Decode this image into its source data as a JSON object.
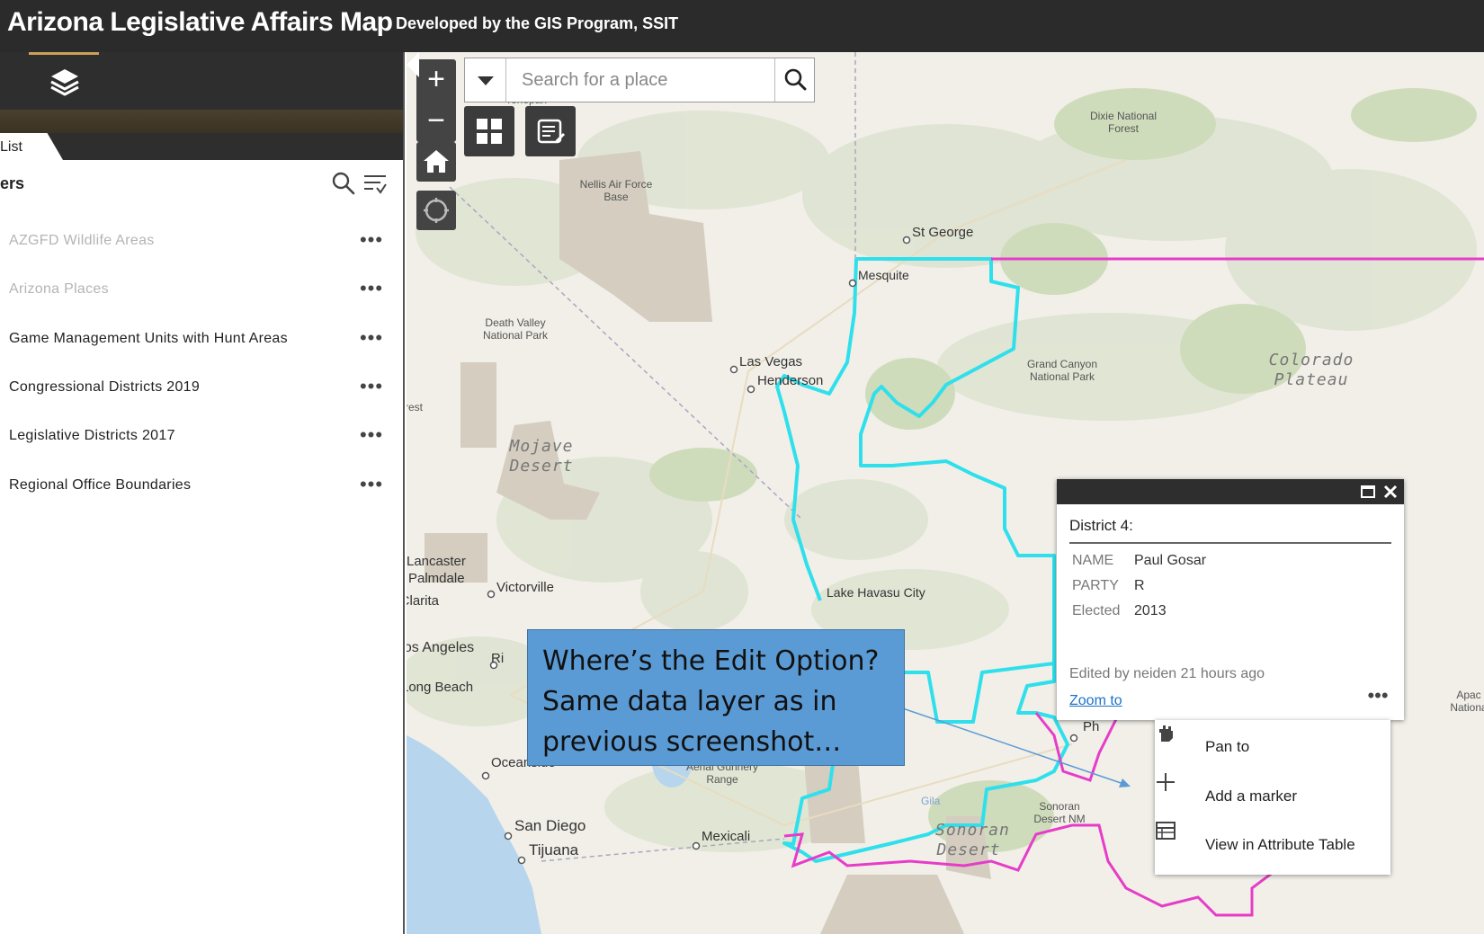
{
  "header": {
    "title": "Arizona Legislative Affairs Map",
    "subtitle": "Developed by the GIS Program, SSIT"
  },
  "panel": {
    "tab_label": "List",
    "section_title": "ers",
    "layers": [
      {
        "label": "AZGFD Wildlife Areas",
        "visible": false
      },
      {
        "label": "Arizona Places",
        "visible": false
      },
      {
        "label": "Game Management Units with Hunt Areas",
        "visible": true
      },
      {
        "label": "Congressional Districts 2019",
        "visible": true
      },
      {
        "label": "Legislative Districts 2017",
        "visible": true
      },
      {
        "label": "Regional Office Boundaries",
        "visible": true
      }
    ],
    "more_label": "•••"
  },
  "map": {
    "search": {
      "placeholder": "Search for a place"
    },
    "zoom_in_label": "+",
    "zoom_out_label": "−",
    "labels": {
      "tonopah": "Tonopah",
      "nellis": "Nellis Air Force Base",
      "dixie": "Dixie National Forest",
      "st_george": "St George",
      "mesquite": "Mesquite",
      "death_valley": "Death Valley National Park",
      "las_vegas": "Las Vegas",
      "henderson": "Henderson",
      "grand_canyon": "Grand Canyon National Park",
      "colorado_plateau": "Colorado Plateau",
      "forest": "rest",
      "mojave": "Mojave Desert",
      "lancaster": "Lancaster",
      "palmdale": "Palmdale",
      "victorville": "Victorville",
      "santa_clarita": "ta Clarita",
      "lake_havasu": "Lake Havasu City",
      "los_angeles": "Los Angeles",
      "riverside": "Ri",
      "long_beach": "Long Beach",
      "oceanside": "Oceanside",
      "chocolate": "Chocolate Mtn Aerial Gunnery Range",
      "san_diego": "San Diego",
      "tijuana": "Tijuana",
      "mexicali": "Mexicali",
      "sonoran_nm": "Sonoran Desert NM",
      "sonoran": "Sonoran Desert",
      "gila": "Gila",
      "apache": "Apac Nationa",
      "phoenix": "Ph"
    }
  },
  "callout": {
    "text": "Where’s the Edit Option? Same data layer as in previous screenshot…"
  },
  "popup": {
    "title": "District 4:",
    "attributes": [
      {
        "key": "NAME",
        "value": "Paul Gosar"
      },
      {
        "key": "PARTY",
        "value": "R"
      },
      {
        "key": "Elected",
        "value": "2013"
      }
    ],
    "edited": "Edited by neiden 21 hours ago",
    "zoom_to": "Zoom to",
    "more_label": "•••",
    "menu": [
      {
        "label": "Pan to",
        "icon": "pan-icon"
      },
      {
        "label": "Add a marker",
        "icon": "plus-icon"
      },
      {
        "label": "View in Attribute Table",
        "icon": "table-icon"
      }
    ]
  },
  "colors": {
    "header_bg": "#2b2b2b",
    "district_cyan": "#2fe0ec",
    "district_magenta": "#e63cc8",
    "callout_bg": "#5b9bd5",
    "link": "#1a73c6"
  }
}
